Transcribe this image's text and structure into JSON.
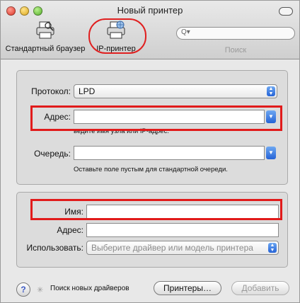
{
  "window": {
    "title": "Новый принтер"
  },
  "toolbar": {
    "default_browser_label": "Стандартный браузер",
    "ip_printer_label": "IP-принтер",
    "search_label": "Поиск",
    "search_placeholder": ""
  },
  "connection": {
    "protocol_label": "Протокол:",
    "protocol_value": "LPD",
    "address_label": "Адрес:",
    "address_value": "",
    "address_hint": "ведите имя узла или IP-адрес.",
    "queue_label": "Очередь:",
    "queue_value": "",
    "queue_hint": "Оставьте поле пустым для стандартной очереди."
  },
  "printer_info": {
    "name_label": "Имя:",
    "name_value": "",
    "address_label": "Адрес:",
    "address_value": "",
    "use_label": "Использовать:",
    "use_value": "Выберите драйвер или модель принтера"
  },
  "footer": {
    "help_symbol": "?",
    "status_text": "Поиск новых драйверов",
    "printers_button": "Принтеры…",
    "add_button": "Добавить"
  },
  "annotations": {
    "highlight_color": "#e11b1b"
  }
}
